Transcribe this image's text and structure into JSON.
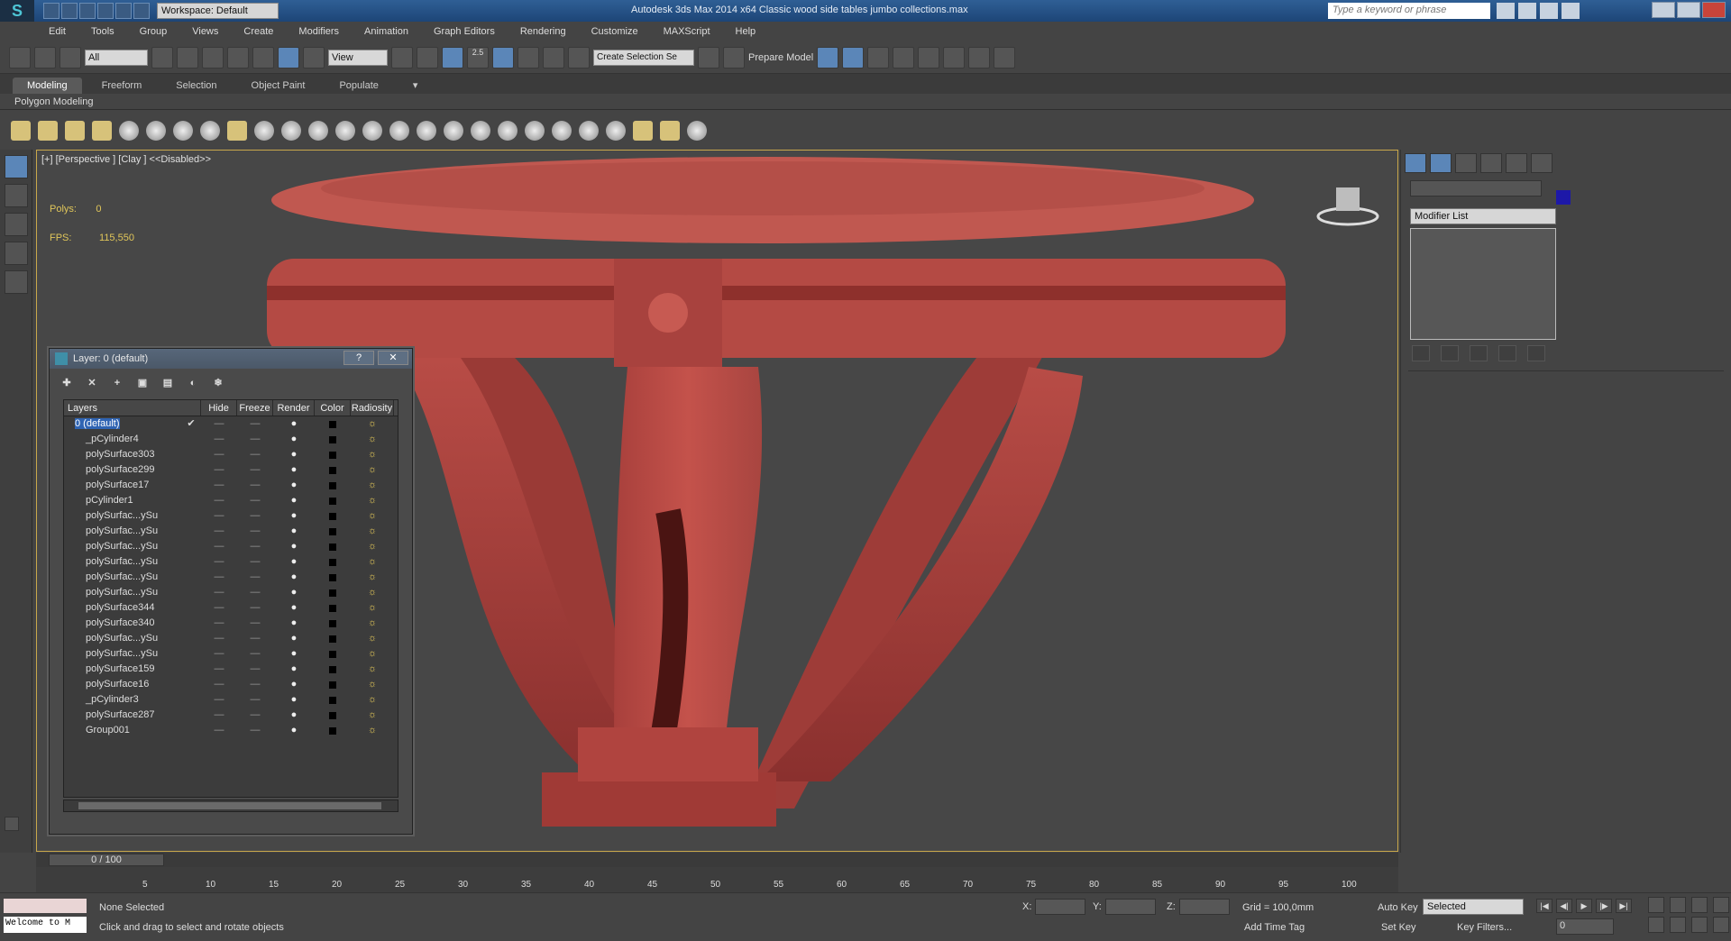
{
  "window": {
    "title": "Autodesk 3ds Max  2014 x64      Classic wood side tables  jumbo collections.max",
    "workspace": "Workspace: Default",
    "search_placeholder": "Type a keyword or phrase"
  },
  "menu": [
    "Edit",
    "Tools",
    "Group",
    "Views",
    "Create",
    "Modifiers",
    "Animation",
    "Graph Editors",
    "Rendering",
    "Customize",
    "MAXScript",
    "Help"
  ],
  "toolbar": {
    "filter": "All",
    "ref_coord": "View",
    "snap_angle": "2.5",
    "selection_set": "Create Selection Se",
    "prepare_model": "Prepare Model"
  },
  "ribbon": {
    "tabs": [
      "Modeling",
      "Freeform",
      "Selection",
      "Object Paint",
      "Populate"
    ],
    "panel": "Polygon Modeling"
  },
  "viewport": {
    "label": "[+] [Perspective ] [Clay ]  <<Disabled>>",
    "polys_label": "Polys:",
    "polys_value": "0",
    "fps_label": "FPS:",
    "fps_value": "115,550"
  },
  "command_panel": {
    "modifier_list": "Modifier List",
    "object_color": "#1d18a8"
  },
  "layer_window": {
    "title": "Layer: 0 (default)",
    "help": "?",
    "close": "✕",
    "columns": [
      "Layers",
      "Hide",
      "Freeze",
      "Render",
      "Color",
      "Radiosity"
    ],
    "layer_top": "0 (default)",
    "objects": [
      "_pCylinder4",
      "polySurface303",
      "polySurface299",
      "polySurface17",
      "pCylinder1",
      "polySurfac...ySu",
      "polySurfac...ySu",
      "polySurfac...ySu",
      "polySurfac...ySu",
      "polySurfac...ySu",
      "polySurfac...ySu",
      "polySurface344",
      "polySurface340",
      "polySurfac...ySu",
      "polySurfac...ySu",
      "polySurface159",
      "polySurface16",
      "_pCylinder3",
      "polySurface287",
      "Group001"
    ]
  },
  "timeline": {
    "frame_display": "0 / 100",
    "ticks": [
      "5",
      "10",
      "15",
      "20",
      "25",
      "30",
      "35",
      "40",
      "45",
      "50",
      "55",
      "60",
      "65",
      "70",
      "75",
      "80",
      "85",
      "90",
      "95",
      "100"
    ]
  },
  "status": {
    "listener": "Welcome to M",
    "selection": "None Selected",
    "prompt": "Click and drag to select and rotate objects",
    "x_label": "X:",
    "y_label": "Y:",
    "z_label": "Z:",
    "grid": "Grid = 100,0mm",
    "add_time_tag": "Add Time Tag",
    "auto_key": "Auto Key",
    "set_key": "Set Key",
    "key_mode": "Selected",
    "key_filters": "Key Filters...",
    "current_frame": "0"
  }
}
